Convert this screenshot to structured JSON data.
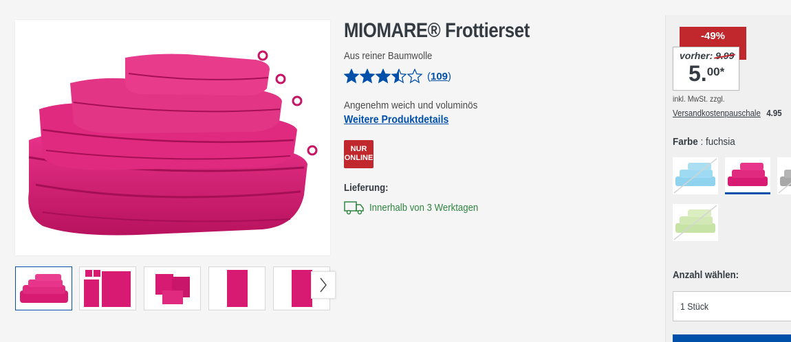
{
  "product": {
    "title": "MIOMARE® Frottierset",
    "subtitle": "Aus reiner Baumwolle",
    "rating_stars": 3.5,
    "rating_max": 5,
    "rating_count": "109",
    "rating_open": "(",
    "rating_close": ")",
    "description": "Angenehm weich und voluminös",
    "details_link": "Weitere Produktdetails",
    "badge_line1": "NUR",
    "badge_line2": "ONLINE",
    "delivery_label": "Lieferung:",
    "delivery_text": "Innerhalb von 3 Werktagen",
    "image_alt": "fuchsia towel set"
  },
  "gallery": {
    "thumbnail_count": 5,
    "active_index": 0,
    "next_icon": "chevron-right-icon"
  },
  "price": {
    "discount": "-49%",
    "previous_label": "vorher:",
    "previous_value": "9.99",
    "current_main": "5.",
    "current_cents": "00*",
    "vat_note": "inkl. MwSt. zzgl.",
    "shipping_label": "Versandkostenpauschale",
    "shipping_value": "4.95"
  },
  "variants": {
    "color_label": "Farbe",
    "color_separator": " : ",
    "color_value": "fuchsia",
    "swatches": [
      {
        "name": "light blue",
        "color": "#8fd3ee",
        "available": false
      },
      {
        "name": "fuchsia",
        "color": "#d81b72",
        "available": true,
        "selected": true
      },
      {
        "name": "grey",
        "color": "#a8a8a8",
        "available": false
      },
      {
        "name": "light green",
        "color": "#c7e3a6",
        "available": false
      }
    ]
  },
  "quantity": {
    "label": "Anzahl wählen:",
    "selected": "1 Stück"
  },
  "colors": {
    "accent": "#0050aa",
    "sale_red": "#c0282d",
    "delivery_green": "#2e8540",
    "towel": "#d81b72"
  }
}
